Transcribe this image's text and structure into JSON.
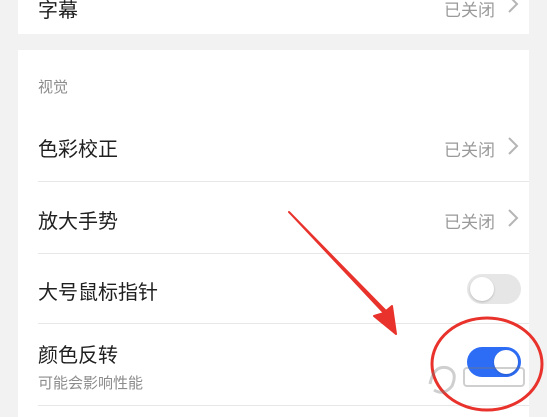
{
  "top_row": {
    "title": "字幕",
    "value": "已关闭"
  },
  "section": {
    "label": "视觉"
  },
  "rows": [
    {
      "title": "色彩校正",
      "value": "已关闭"
    },
    {
      "title": "放大手势",
      "value": "已关闭"
    },
    {
      "title": "大号鼠标指针",
      "toggle_on": false
    },
    {
      "title": "颜色反转",
      "subtitle": "可能会影响性能",
      "toggle_on": true
    }
  ],
  "annotation": {
    "color": "#e8322b"
  },
  "colors": {
    "accent": "#2d6df6"
  }
}
